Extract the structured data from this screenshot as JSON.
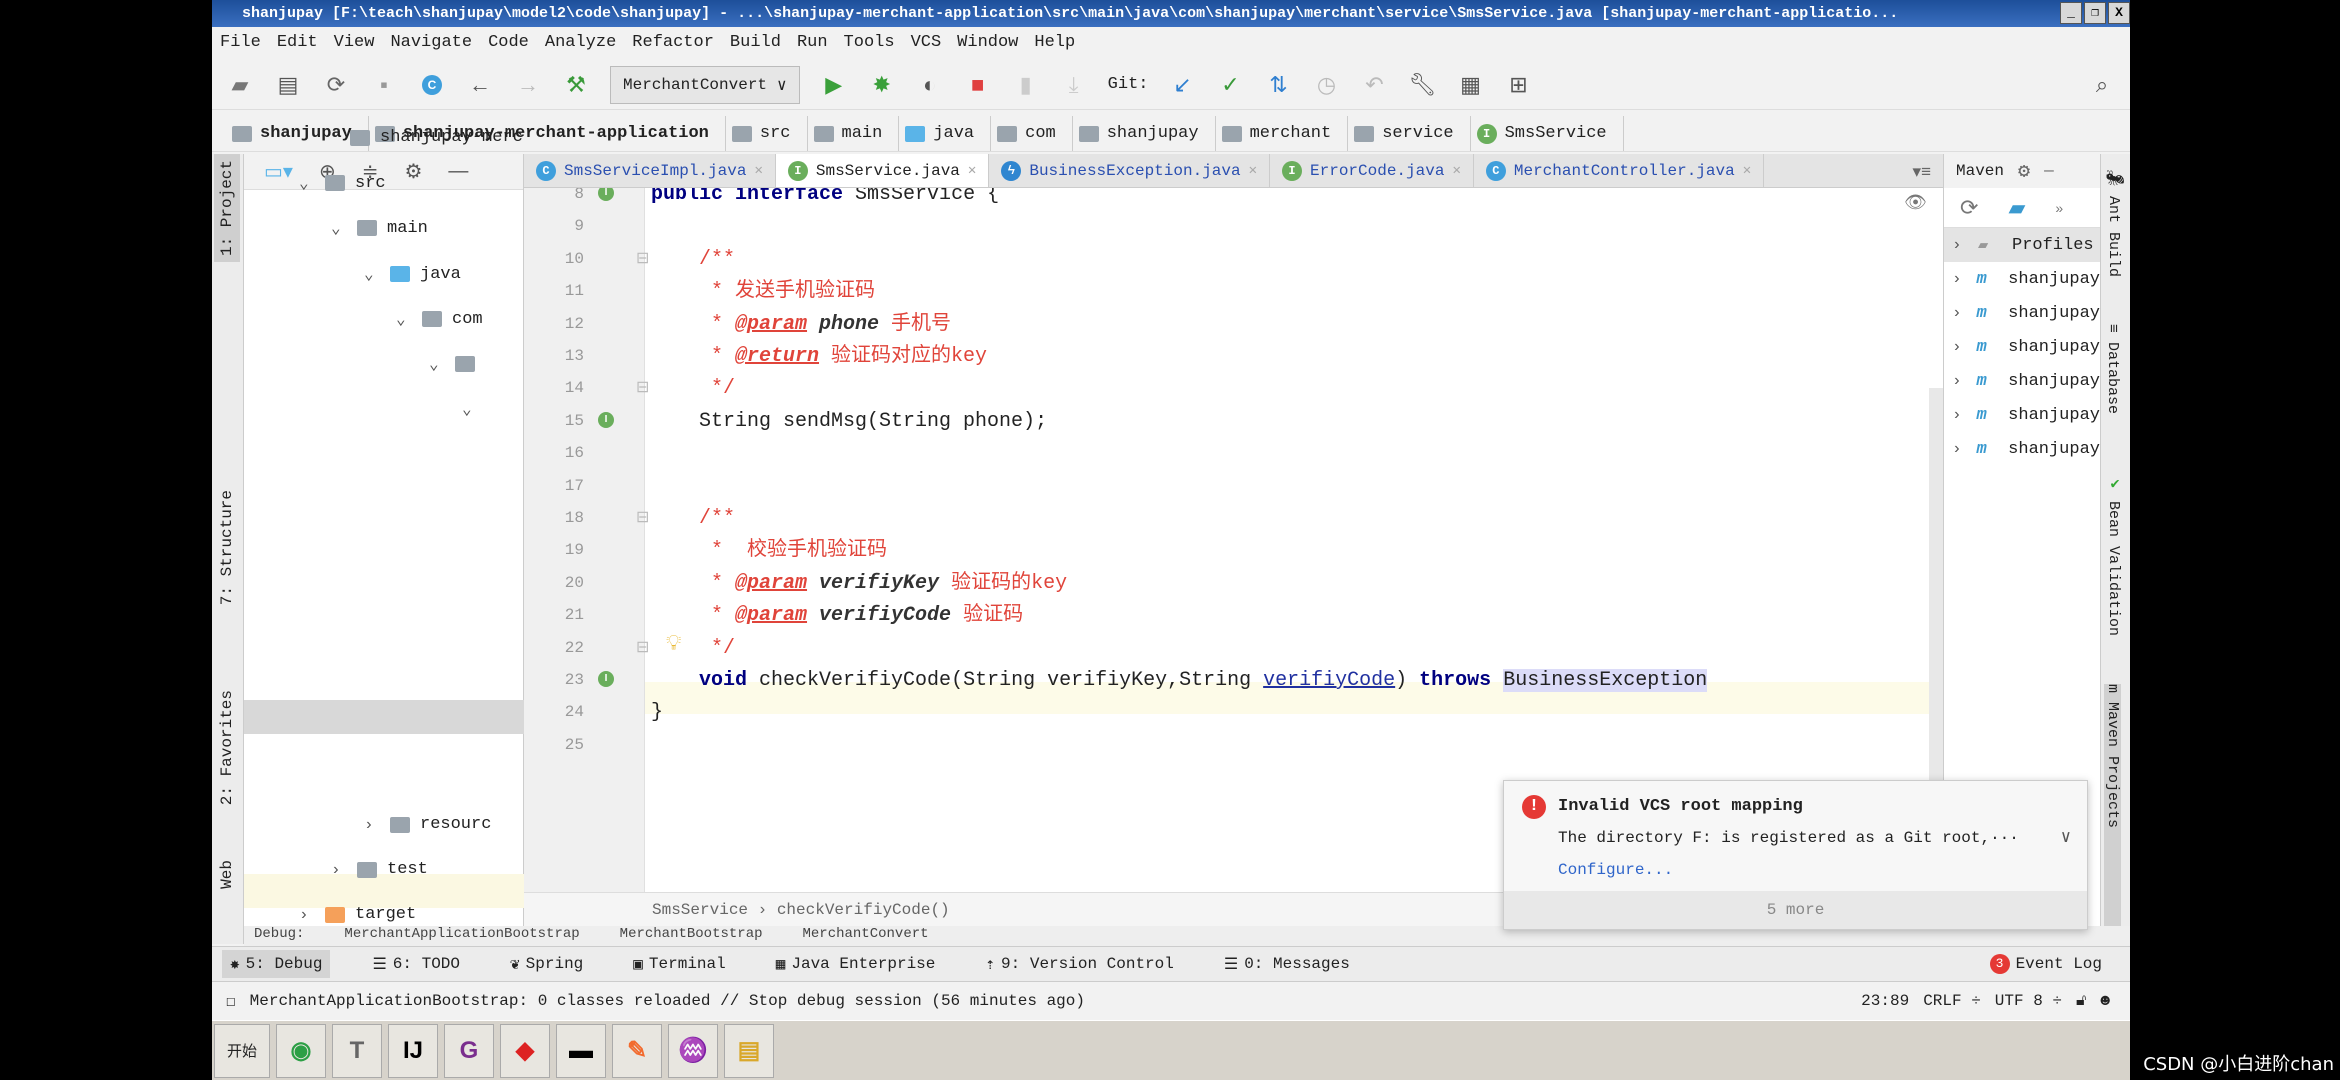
{
  "window": {
    "title": "shanjupay [F:\\teach\\shanjupay\\model2\\code\\shanjupay] - ...\\shanjupay-merchant-application\\src\\main\\java\\com\\shanjupay\\merchant\\service\\SmsService.java [shanjupay-merchant-applicatio..."
  },
  "menu": [
    "File",
    "Edit",
    "View",
    "Navigate",
    "Code",
    "Analyze",
    "Refactor",
    "Build",
    "Run",
    "Tools",
    "VCS",
    "Window",
    "Help"
  ],
  "toolbar": {
    "run_config": "MerchantConvert",
    "git_label": "Git:"
  },
  "breadcrumb": [
    "shanjupay",
    "shanjupay-merchant-application",
    "src",
    "main",
    "java",
    "com",
    "shanjupay",
    "merchant",
    "service",
    "SmsService"
  ],
  "project_tree": [
    {
      "label": "shanjupay-merc",
      "chev": "",
      "icon": "module"
    },
    {
      "label": "src",
      "chev": "v",
      "icon": "folder"
    },
    {
      "label": "main",
      "chev": "v",
      "icon": "folder"
    },
    {
      "label": "java",
      "chev": "v",
      "icon": "folder-blue"
    },
    {
      "label": "com",
      "chev": "v",
      "icon": "package"
    },
    {
      "label": "",
      "chev": "v",
      "icon": "package"
    },
    {
      "label": "",
      "chev": "v",
      "icon": ""
    },
    {
      "label": "resourc",
      "chev": ">",
      "icon": "folder"
    },
    {
      "label": "test",
      "chev": ">",
      "icon": "folder"
    },
    {
      "label": "target",
      "chev": ">",
      "icon": "folder-orange"
    },
    {
      "label": "External Libraries",
      "chev": ">",
      "icon": "library"
    }
  ],
  "left_tool_tabs": [
    "1: Project",
    "7: Structure",
    "2: Favorites",
    "Web"
  ],
  "editor_tabs": [
    {
      "label": "SmsServiceImpl.java",
      "type": "C",
      "active": false
    },
    {
      "label": "SmsService.java",
      "type": "I",
      "active": true
    },
    {
      "label": "BusinessException.java",
      "type": "E",
      "active": false
    },
    {
      "label": "ErrorCode.java",
      "type": "I",
      "active": false
    },
    {
      "label": "MerchantController.java",
      "type": "C",
      "active": false
    }
  ],
  "code": [
    {
      "n": "8",
      "t": [
        [
          "kw",
          "public interface "
        ],
        [
          "pl",
          "SmsService {"
        ]
      ]
    },
    {
      "n": "9",
      "t": []
    },
    {
      "n": "10",
      "t": [
        [
          "cm",
          "    /**"
        ]
      ]
    },
    {
      "n": "11",
      "t": [
        [
          "cm",
          "     * 发送手机验证码"
        ]
      ]
    },
    {
      "n": "12",
      "t": [
        [
          "cm",
          "     * "
        ],
        [
          "tag",
          "@param"
        ],
        [
          "pn",
          " phone"
        ],
        [
          "cm",
          " 手机号"
        ]
      ]
    },
    {
      "n": "13",
      "t": [
        [
          "cm",
          "     * "
        ],
        [
          "tag",
          "@return"
        ],
        [
          "cm",
          " 验证码对应的key"
        ]
      ]
    },
    {
      "n": "14",
      "t": [
        [
          "cm",
          "     */"
        ]
      ]
    },
    {
      "n": "15",
      "t": [
        [
          "pl",
          "    String sendMsg(String phone);"
        ]
      ]
    },
    {
      "n": "16",
      "t": []
    },
    {
      "n": "17",
      "t": []
    },
    {
      "n": "18",
      "t": [
        [
          "cm",
          "    /**"
        ]
      ]
    },
    {
      "n": "19",
      "t": [
        [
          "cm",
          "     *  校验手机验证码"
        ]
      ]
    },
    {
      "n": "20",
      "t": [
        [
          "cm",
          "     * "
        ],
        [
          "tag",
          "@param"
        ],
        [
          "pn",
          " verifiyKey"
        ],
        [
          "cm",
          " 验证码的key"
        ]
      ]
    },
    {
      "n": "21",
      "t": [
        [
          "cm",
          "     * "
        ],
        [
          "tag",
          "@param"
        ],
        [
          "pn",
          " verifiyCode"
        ],
        [
          "cm",
          " 验证码"
        ]
      ]
    },
    {
      "n": "22",
      "t": [
        [
          "cm",
          "     */"
        ]
      ]
    },
    {
      "n": "23",
      "t": [
        [
          "kw",
          "    void "
        ],
        [
          "pl",
          "checkVerifiyCode(String verifiyKey,String "
        ],
        [
          "lnk",
          "verifiyCode"
        ],
        [
          "pl",
          ") "
        ],
        [
          "kw",
          "throws "
        ],
        [
          "sel",
          "BusinessException"
        ]
      ]
    },
    {
      "n": "24",
      "t": [
        [
          "pl",
          "}"
        ]
      ]
    },
    {
      "n": "25",
      "t": []
    }
  ],
  "editor_breadcrumb": "SmsService  ›  checkVerifiyCode()",
  "maven": {
    "title": "Maven",
    "items": [
      "Profiles",
      "shanjupay",
      "shanjupay",
      "shanjupay",
      "shanjupay",
      "shanjupay",
      "shanjupay"
    ]
  },
  "right_tool_tabs": [
    "Ant Build",
    "Database",
    "Bean Validation",
    "Maven Projects"
  ],
  "notification": {
    "title": "Invalid VCS root mapping",
    "body": "The directory F: is registered as a Git root,···",
    "link": "Configure...",
    "more": "5 more"
  },
  "debug_row": {
    "label": "Debug:",
    "sessions": [
      "MerchantApplicationBootstrap",
      "MerchantBootstrap",
      "MerchantConvert"
    ]
  },
  "tool_windows": [
    "5: Debug",
    "6: TODO",
    "Spring",
    "Terminal",
    "Java Enterprise",
    "9: Version Control",
    "0: Messages"
  ],
  "event_log": {
    "label": "Event Log",
    "count": "3"
  },
  "status": {
    "message": "MerchantApplicationBootstrap: 0 classes reloaded // Stop debug session (56 minutes ago)",
    "position": "23:89",
    "line_sep": "CRLF ÷",
    "encoding": "UTF 8 ÷"
  },
  "taskbar": {
    "start": "开始",
    "apps": [
      "chrome",
      "typora",
      "intellij",
      "pdf",
      "redis",
      "cmd",
      "postman",
      "mysql",
      "explorer"
    ]
  },
  "watermark": "CSDN @小白进阶chan",
  "colors": {
    "accent": "#2f65ca",
    "comment": "#e0443a",
    "keyword": "#000080",
    "error": "#e53935"
  }
}
